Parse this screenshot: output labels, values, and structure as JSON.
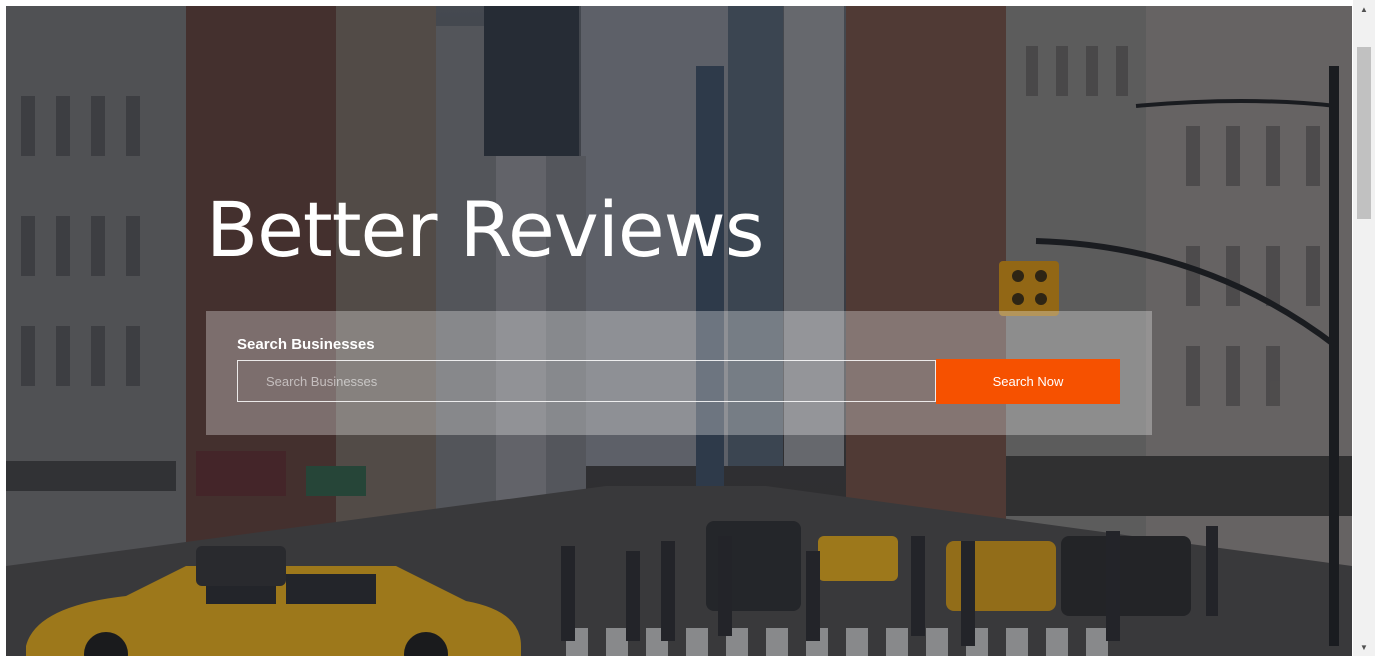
{
  "hero": {
    "title": "Better Reviews",
    "background_image": "city-street-photo"
  },
  "search": {
    "label": "Search Businesses",
    "placeholder": "Search Businesses",
    "value": "",
    "button_label": "Search Now"
  },
  "scrollbar": {
    "up_icon": "scroll-up-arrow-icon",
    "down_icon": "scroll-down-arrow-icon"
  },
  "colors": {
    "accent": "#f65100",
    "title": "#ffffff",
    "panel": "rgba(255,255,255,0.30)"
  }
}
